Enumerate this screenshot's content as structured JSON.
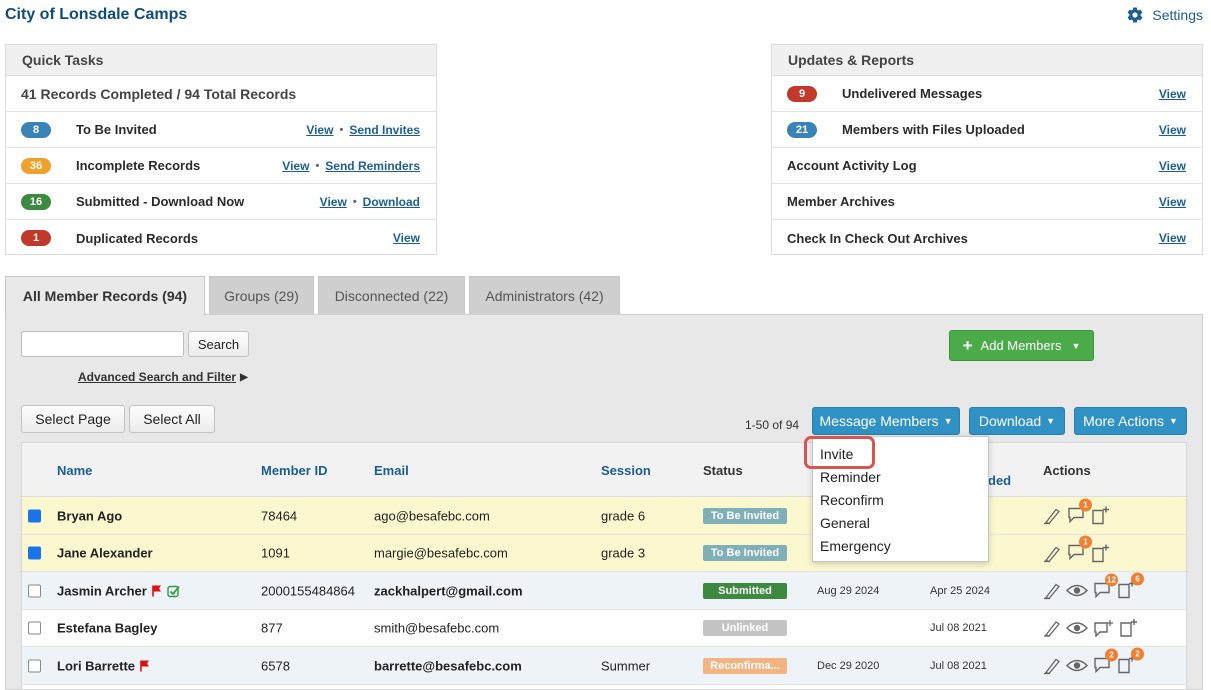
{
  "header": {
    "app_title": "City of Lonsdale Camps",
    "settings_label": "Settings"
  },
  "quick_tasks": {
    "title": "Quick Tasks",
    "summary": "41 Records Completed / 94 Total Records",
    "rows": [
      {
        "count": "8",
        "color": "#3a83b6",
        "label": "To Be Invited",
        "view": "View",
        "action": "Send Invites"
      },
      {
        "count": "36",
        "color": "#f0a12b",
        "label": "Incomplete Records",
        "view": "View",
        "action": "Send Reminders"
      },
      {
        "count": "16",
        "color": "#3b8a3f",
        "label": "Submitted - Download Now",
        "view": "View",
        "action": "Download"
      },
      {
        "count": "1",
        "color": "#c0392b",
        "label": "Duplicated Records",
        "view": "View"
      }
    ]
  },
  "updates_reports": {
    "title": "Updates & Reports",
    "rows": [
      {
        "count": "9",
        "color": "#c0392b",
        "label": "Undelivered Messages",
        "view": "View"
      },
      {
        "count": "21",
        "color": "#3a83b6",
        "label": "Members with Files Uploaded",
        "view": "View"
      },
      {
        "label": "Account Activity Log",
        "view": "View"
      },
      {
        "label": "Member Archives",
        "view": "View"
      },
      {
        "label": "Check In Check Out Archives",
        "view": "View"
      }
    ]
  },
  "tabs": [
    {
      "label": "All Member Records (94)",
      "active": true
    },
    {
      "label": "Groups (29)",
      "active": false
    },
    {
      "label": "Disconnected (22)",
      "active": false
    },
    {
      "label": "Administrators (42)",
      "active": false
    }
  ],
  "toolbar": {
    "search_value": "",
    "search_button": "Search",
    "advanced_search": "Advanced Search and Filter",
    "add_members": "Add Members",
    "select_page": "Select Page",
    "select_all": "Select All",
    "pagination": "1-50 of 94",
    "message_members": "Message Members",
    "download": "Download",
    "more_actions": "More Actions"
  },
  "message_menu": {
    "items": [
      "Invite",
      "Reminder",
      "Reconfirm",
      "General",
      "Emergency"
    ],
    "highlighted": "Invite"
  },
  "table": {
    "headers": {
      "name": "Name",
      "member_id": "Member ID",
      "email": "Email",
      "session": "Session",
      "status": "Status",
      "uploaded_partial": "ded",
      "actions": "Actions"
    },
    "rows": [
      {
        "checked": true,
        "name": "Bryan Ago",
        "member_id": "78464",
        "email": "ago@besafebc.com",
        "email_bold": false,
        "session": "grade 6",
        "status": "To Be Invited",
        "status_color": "#7fb0b8",
        "date1": "",
        "date2": "",
        "highlight": true,
        "flag": false,
        "check": false,
        "icons": "chat1"
      },
      {
        "checked": true,
        "name": "Jane Alexander",
        "member_id": "1091",
        "email": "margie@besafebc.com",
        "email_bold": false,
        "session": "grade 3",
        "status": "To Be Invited",
        "status_color": "#7fb0b8",
        "date1": "",
        "date2": "",
        "highlight": true,
        "flag": false,
        "check": false,
        "icons": "chat1"
      },
      {
        "checked": false,
        "name": "Jasmin Archer",
        "member_id": "2000155484864",
        "email": "zackhalpert@gmail.com",
        "email_bold": true,
        "session": "",
        "status": "Submitted",
        "status_color": "#3b8a3f",
        "date1": "Aug 29 2024",
        "date2": "Apr 25 2024",
        "highlight": false,
        "flag": true,
        "check": true,
        "icons": "full-badged",
        "badge_chat": "12",
        "badge_doc": "6"
      },
      {
        "checked": false,
        "name": "Estefana Bagley",
        "member_id": "877",
        "email": "smith@besafebc.com",
        "email_bold": false,
        "session": "",
        "status": "Unlinked",
        "status_color": "#c4c4c4",
        "date1": "",
        "date2": "Jul 08 2021",
        "highlight": false,
        "flag": false,
        "check": false,
        "icons": "full"
      },
      {
        "checked": false,
        "name": "Lori Barrette",
        "member_id": "6578",
        "email": "barrette@besafebc.com",
        "email_bold": true,
        "session": "Summer",
        "status": "Reconfirma...",
        "status_color": "#f3b483",
        "date1": "Dec 29 2020",
        "date2": "Jul 08 2021",
        "highlight": false,
        "flag": true,
        "check": false,
        "icons": "full-badged",
        "badge_chat": "2",
        "badge_doc": "2"
      }
    ],
    "chat_badge_small": "1"
  }
}
